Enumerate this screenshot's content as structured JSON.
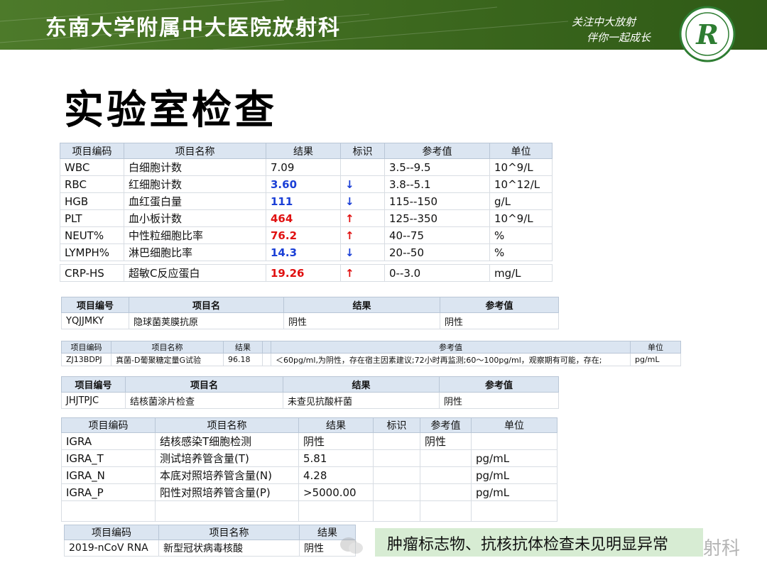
{
  "header": {
    "title": "东南大学附属中大医院放射科",
    "slogan_line1": "关注中大放射",
    "slogan_line2": "伴你一起成长",
    "logo_letter": "R",
    "brand_color": "#3f6b20"
  },
  "page_title": "实验室检查",
  "cbc": {
    "headers": [
      "项目编码",
      "项目名称",
      "结果",
      "标识",
      "参考值",
      "单位"
    ],
    "rows": [
      {
        "code": "WBC",
        "name": "白细胞计数",
        "result": "7.09",
        "flag": "",
        "ref": "3.5--9.5",
        "unit": "10^9/L"
      },
      {
        "code": "RBC",
        "name": "红细胞计数",
        "result": "3.60",
        "flag": "↓",
        "ref": "3.8--5.1",
        "unit": "10^12/L"
      },
      {
        "code": "HGB",
        "name": "血红蛋白量",
        "result": "111",
        "flag": "↓",
        "ref": "115--150",
        "unit": "g/L"
      },
      {
        "code": "PLT",
        "name": "血小板计数",
        "result": "464",
        "flag": "↑",
        "ref": "125--350",
        "unit": "10^9/L"
      },
      {
        "code": "NEUT%",
        "name": "中性粒细胞比率",
        "result": "76.2",
        "flag": "↑",
        "ref": "40--75",
        "unit": "%"
      },
      {
        "code": "LYMPH%",
        "name": "淋巴细胞比率",
        "result": "14.3",
        "flag": "↓",
        "ref": "20--50",
        "unit": "%"
      },
      {
        "code": "CRP-HS",
        "name": "超敏C反应蛋白",
        "result": "19.26",
        "flag": "↑",
        "ref": "0--3.0",
        "unit": "mg/L"
      }
    ]
  },
  "crypto": {
    "headers": [
      "项目编号",
      "项目名",
      "结果",
      "参考值"
    ],
    "row": {
      "code": "YQJJMKY",
      "name": "隐球菌荚膜抗原",
      "result": "阴性",
      "ref": "阴性"
    }
  },
  "gtest": {
    "headers": [
      "项目编码",
      "项目名称",
      "结果",
      "",
      "参考值",
      "单位"
    ],
    "row": {
      "code": "ZJ13BDPJ",
      "name": "真菌-D葡聚糖定量G试验",
      "result": "96.18",
      "flag": "",
      "ref": "＜60pg/ml,为阴性，存在宿主因素建议;72小时再监测;60～100pg/ml，观察期有可能，存在;",
      "unit": "pg/mL"
    }
  },
  "tb_smear": {
    "headers": [
      "项目编号",
      "项目名",
      "结果",
      "参考值"
    ],
    "row": {
      "code": "JHJTPJC",
      "name": "结核菌涂片检查",
      "result": "未查见抗酸杆菌",
      "ref": "阴性"
    }
  },
  "igra": {
    "headers": [
      "项目编码",
      "项目名称",
      "结果",
      "标识",
      "参考值",
      "单位"
    ],
    "rows": [
      {
        "code": "IGRA",
        "name": "结核感染T细胞检测",
        "result": "阴性",
        "flag": "",
        "ref": "阴性",
        "unit": ""
      },
      {
        "code": "IGRA_T",
        "name": "测试培养管含量(T)",
        "result": "5.81",
        "flag": "",
        "ref": "",
        "unit": "pg/mL"
      },
      {
        "code": "IGRA_N",
        "name": "本底对照培养管含量(N)",
        "result": "4.28",
        "flag": "",
        "ref": "",
        "unit": "pg/mL"
      },
      {
        "code": "IGRA_P",
        "name": "阳性对照培养管含量(P)",
        "result": ">5000.00",
        "flag": "",
        "ref": "",
        "unit": "pg/mL"
      }
    ]
  },
  "covid": {
    "headers": [
      "项目编码",
      "项目名称",
      "结果"
    ],
    "row": {
      "code": "2019-nCoV RNA",
      "name": "新型冠状病毒核酸",
      "result": "阴性"
    }
  },
  "note": "肿瘤标志物、抗核抗体检查未见明显异常",
  "watermark": "射科",
  "colors": {
    "low": "#1a3fd6",
    "high": "#e01010",
    "header_bg": "#dbe5f1",
    "note_bg": "#d7ecd3"
  }
}
